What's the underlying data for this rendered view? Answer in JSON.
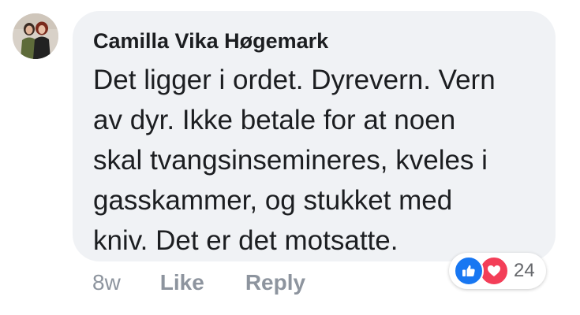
{
  "comment": {
    "author": "Camilla Vika Høgemark",
    "text": "Det ligger i ordet. Dyrevern. Vern\nav dyr. Ikke betale for at noen\nskal tvangsinsemineres, kveles i\ngasskammer, og stukket med\nkniv. Det er det motsatte.",
    "avatar_icon": "profile-photo"
  },
  "actions": {
    "time": "8w",
    "like_label": "Like",
    "reply_label": "Reply"
  },
  "reactions": {
    "icons": [
      "thumbs-up-icon",
      "heart-icon"
    ],
    "count": "24",
    "colors": {
      "like": "#1877f2",
      "love": "#f33e58"
    }
  }
}
